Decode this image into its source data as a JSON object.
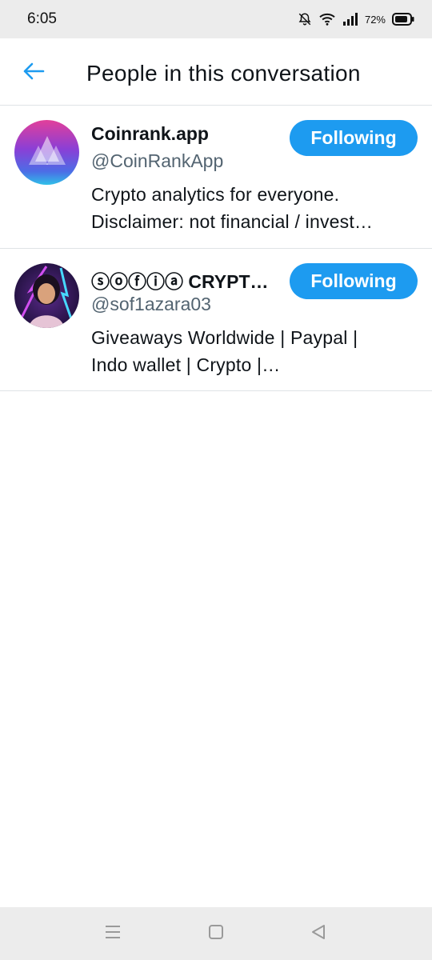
{
  "status_bar": {
    "time": "6:05",
    "battery": "72%",
    "icons": [
      "bell-off-icon",
      "wifi-icon",
      "signal-icon",
      "battery-icon"
    ]
  },
  "header": {
    "title": "People in this conversation",
    "back_icon": "arrow-left-icon"
  },
  "users": [
    {
      "name": "Coinrank.app",
      "handle": "@CoinRankApp",
      "bio_lines": [
        "Crypto analytics for everyone.",
        "Disclaimer: not financial / invest…"
      ],
      "button_label": "Following"
    },
    {
      "name": "ⓢⓞⓕⓘⓐ CRYPT…",
      "handle": "@sof1azara03",
      "bio_lines": [
        "Giveaways Worldwide | Paypal |",
        "Indo wallet | Crypto |…"
      ],
      "button_label": "Following"
    }
  ],
  "colors": {
    "accent": "#1d9bf0",
    "text_primary": "#0f1419",
    "text_secondary": "#536471",
    "divider": "#dfe3e6",
    "system_bar": "#ececec"
  },
  "nav_bar": {
    "icons": [
      "menu-icon",
      "home-square-icon",
      "back-triangle-icon"
    ]
  }
}
